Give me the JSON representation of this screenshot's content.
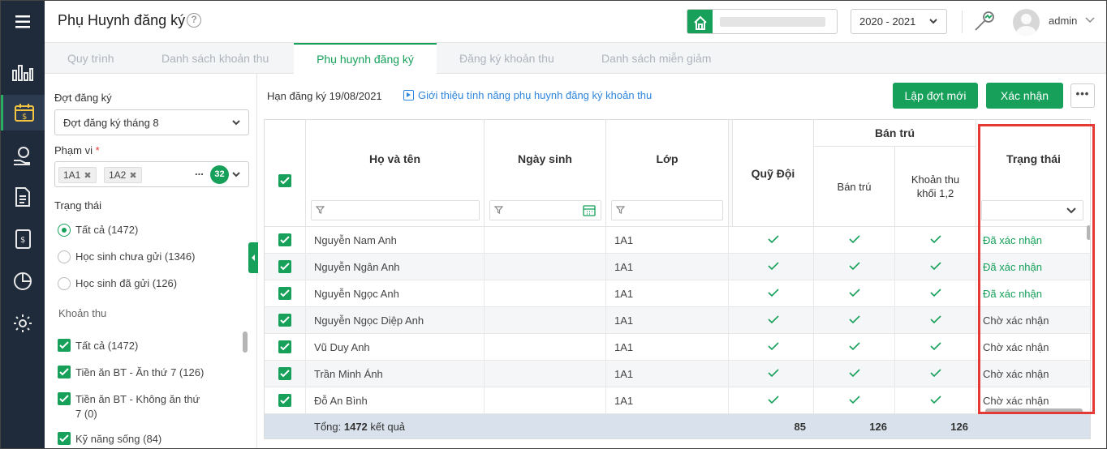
{
  "app": {
    "title": "Phụ Huynh đăng ký",
    "help_icon": "question-icon"
  },
  "topbar": {
    "year": "2020 - 2021",
    "user": "admin"
  },
  "rail": {
    "items": [
      "bar-chart-icon",
      "fee-calendar-icon",
      "money-hand-icon",
      "document-icon",
      "ledger-icon",
      "pie-chart-icon",
      "settings-icon"
    ]
  },
  "tabs": [
    "Quy trình",
    "Danh sách khoản thu",
    "Phụ huynh đăng ký",
    "Đăng ký khoản thu",
    "Danh sách miễn giảm"
  ],
  "sidebar": {
    "period_label": "Đợt đăng ký",
    "period_value": "Đợt đăng ký tháng 8",
    "scope_label": "Phạm vi",
    "scope_required": "*",
    "scope_tags": [
      "1A1",
      "1A2"
    ],
    "scope_more": "...",
    "scope_count": "32",
    "status_label": "Trạng thái",
    "status_options": [
      "Tất cả (1472)",
      "Học sinh chưa gửi (1346)",
      "Học sinh đã gửi (126)"
    ],
    "fee_label": "Khoản thu",
    "fee_options": [
      "Tất cả (1472)",
      "Tiền ăn BT - Ăn thứ 7 (126)",
      "Tiền ăn BT - Không ăn thứ",
      "7 (0)",
      "Kỹ năng sống (84)"
    ]
  },
  "toolbar": {
    "deadline": "Hạn đăng ký 19/08/2021",
    "intro": "Giới thiệu tính năng phụ huynh đăng ký khoản thu",
    "new_button": "Lập đợt mới",
    "confirm_button": "Xác nhận",
    "more_button": "•••"
  },
  "table": {
    "headers": {
      "name": "Họ và tên",
      "dob": "Ngày sinh",
      "class": "Lớp",
      "quy_doi": "Quỹ Đội",
      "ban_tru_group": "Bán trú",
      "ban_tru": "Bán trú",
      "khoan_thu": "Khoản thu",
      "khoan_thu_2": "khối 1,2",
      "status": "Trạng thái"
    },
    "rows": [
      {
        "name": "Nguyễn Nam Anh",
        "dob": "",
        "class": "1A1",
        "status": "Đã xác nhận",
        "confirmed": true
      },
      {
        "name": "Nguyễn Ngân Anh",
        "dob": "",
        "class": "1A1",
        "status": "Đã xác nhận",
        "confirmed": true
      },
      {
        "name": "Nguyễn Ngọc Anh",
        "dob": "",
        "class": "1A1",
        "status": "Đã xác nhận",
        "confirmed": true
      },
      {
        "name": "Nguyễn Ngọc Diệp Anh",
        "dob": "",
        "class": "1A1",
        "status": "Chờ xác nhận",
        "confirmed": false
      },
      {
        "name": "Vũ Duy Anh",
        "dob": "",
        "class": "1A1",
        "status": "Chờ xác nhận",
        "confirmed": false
      },
      {
        "name": "Trần Minh Ánh",
        "dob": "",
        "class": "1A1",
        "status": "Chờ xác nhận",
        "confirmed": false
      },
      {
        "name": "Đỗ An Bình",
        "dob": "",
        "class": "1A1",
        "status": "Chờ xác nhận",
        "confirmed": false
      }
    ],
    "footer": {
      "prefix": "Tổng: ",
      "count": "1472",
      "suffix": " kết quả",
      "quy_doi": "85",
      "ban_tru": "126",
      "khoan_thu": "126"
    }
  },
  "colors": {
    "accent": "#16a05a",
    "confirmed": "#16a05a",
    "highlight": "#e53935"
  }
}
